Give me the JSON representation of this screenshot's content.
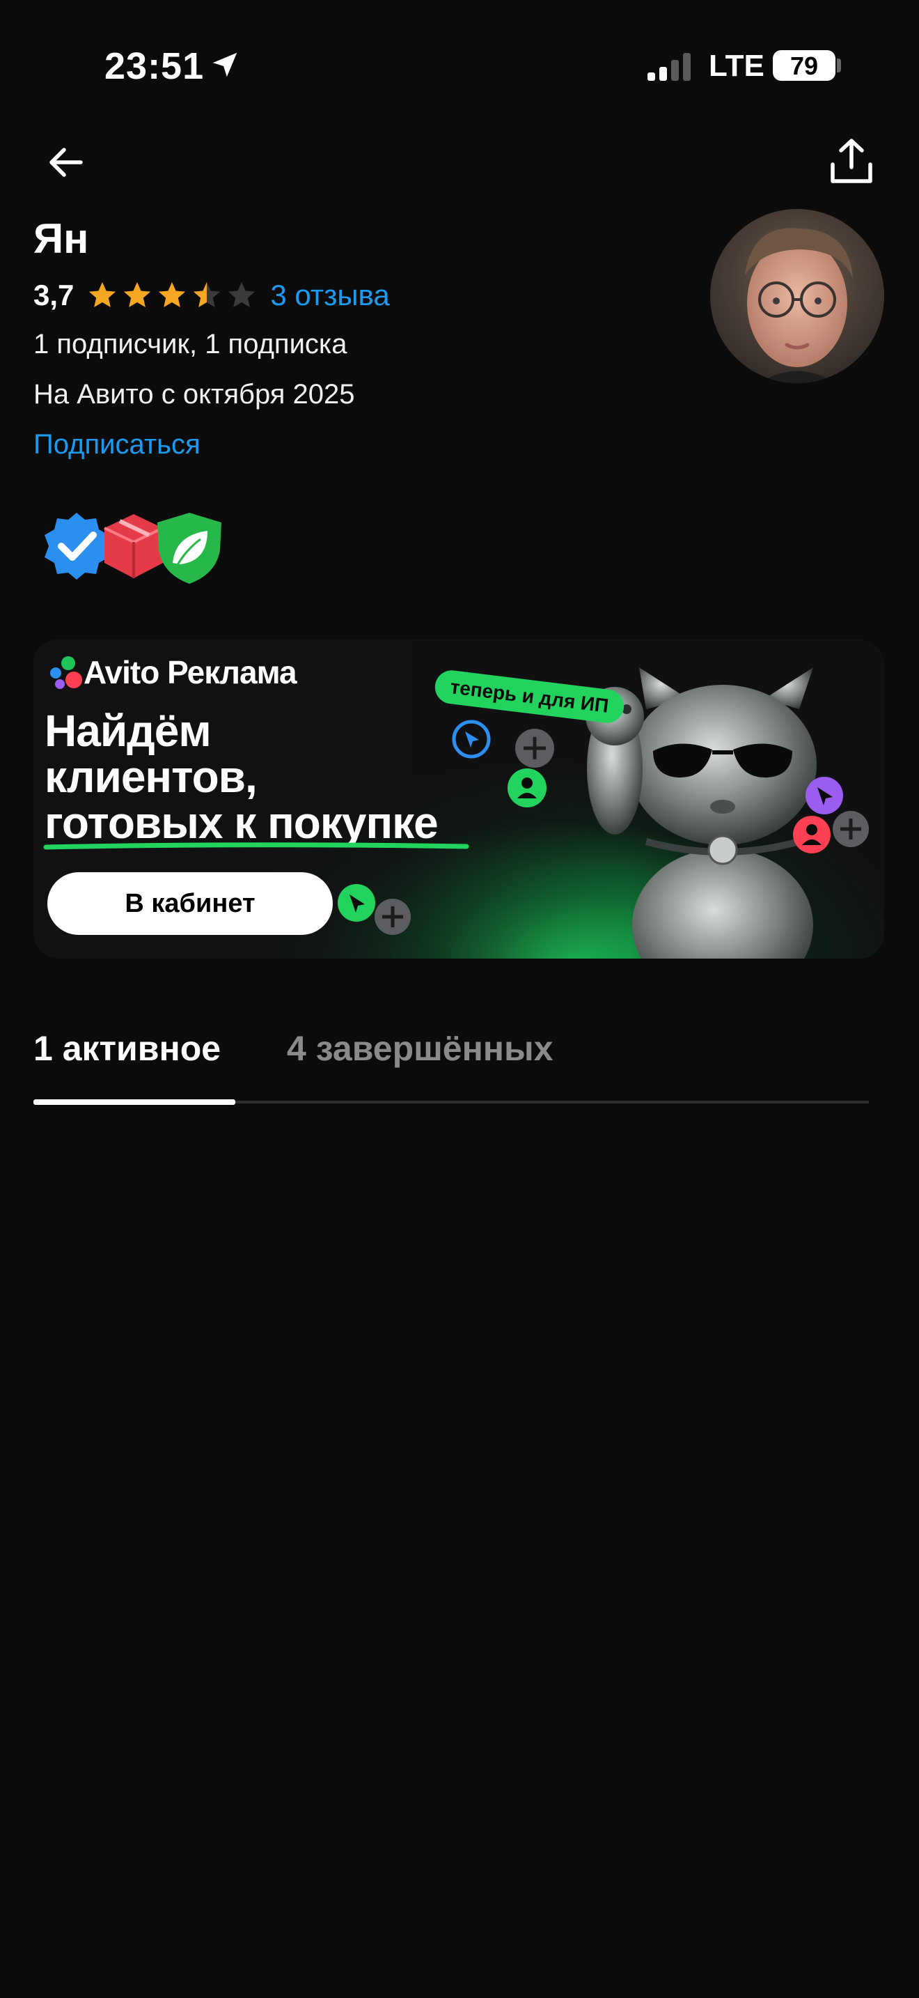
{
  "status_bar": {
    "time": "23:51",
    "network": "LTE",
    "battery": "79",
    "icons": [
      "location-arrow-icon",
      "signal-bars-icon"
    ]
  },
  "toolbar": {
    "back_icon": "arrow-left-icon",
    "share_icon": "share-upload-icon"
  },
  "profile": {
    "name": "Ян",
    "rating": "3,7",
    "stars_filled": 3.5,
    "stars_total": 5,
    "reviews": "3 отзыва",
    "subscribers": "1 подписчик, 1 подписка",
    "since": "На Авито с октября 2025",
    "subscribe": "Подписаться",
    "badges": [
      "verified-badge-icon",
      "delivery-box-badge-icon",
      "eco-leaf-badge-icon"
    ]
  },
  "banner": {
    "brand": "Avito Реклама",
    "headline_1": "Найдём",
    "headline_2": "клиентов,",
    "headline_3": "готовых к покупке",
    "tag": "теперь и для ИП",
    "button": "В кабинет"
  },
  "tabs": {
    "active": "1 активное",
    "inactive": "4 завершённых"
  },
  "colors": {
    "background": "#0b0b0b",
    "link": "#1a9bf0",
    "star": "#f5a623",
    "accent_green": "#22d35e"
  }
}
